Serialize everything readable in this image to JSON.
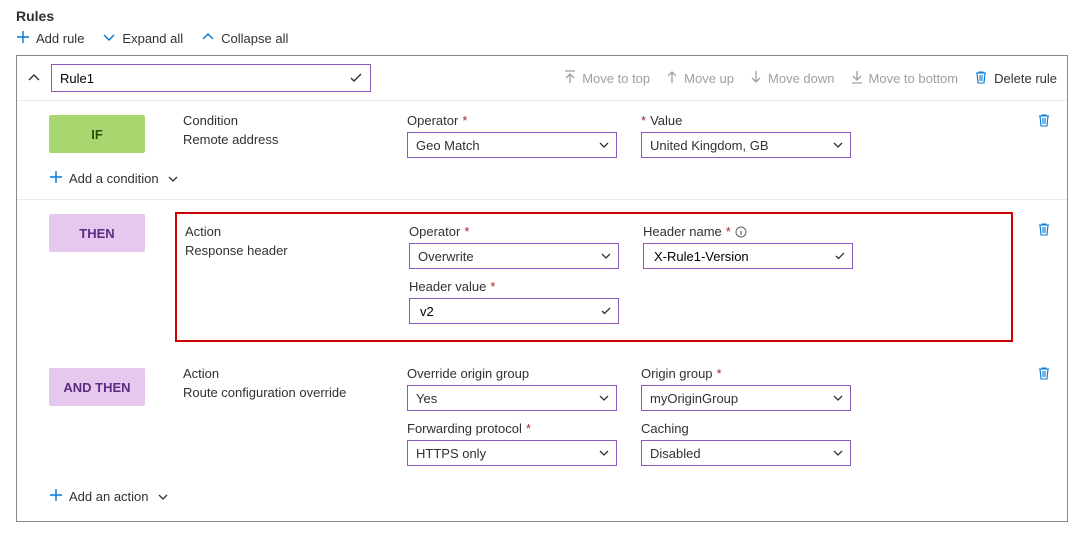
{
  "title": "Rules",
  "toolbar": {
    "add": "Add rule",
    "expand": "Expand all",
    "collapse": "Collapse all"
  },
  "rule": {
    "name": "Rule1",
    "move_top": "Move to top",
    "move_up": "Move up",
    "move_down": "Move down",
    "move_bottom": "Move to bottom",
    "delete": "Delete rule"
  },
  "if": {
    "badge": "IF",
    "condition_label": "Condition",
    "condition_value": "Remote address",
    "operator_label": "Operator",
    "operator_value": "Geo Match",
    "value_label": "Value",
    "value_value": "United Kingdom, GB",
    "add_condition": "Add a condition"
  },
  "then": {
    "badge": "THEN",
    "action_label": "Action",
    "action_value": "Response header",
    "operator_label": "Operator",
    "operator_value": "Overwrite",
    "header_name_label": "Header name",
    "header_name_value": "X-Rule1-Version",
    "header_value_label": "Header value",
    "header_value_value": "v2"
  },
  "andthen": {
    "badge": "AND THEN",
    "action_label": "Action",
    "action_value": "Route configuration override",
    "override_label": "Override origin group",
    "override_value": "Yes",
    "origin_group_label": "Origin group",
    "origin_group_value": "myOriginGroup",
    "forwarding_label": "Forwarding protocol",
    "forwarding_value": "HTTPS only",
    "caching_label": "Caching",
    "caching_value": "Disabled",
    "add_action": "Add an action"
  }
}
